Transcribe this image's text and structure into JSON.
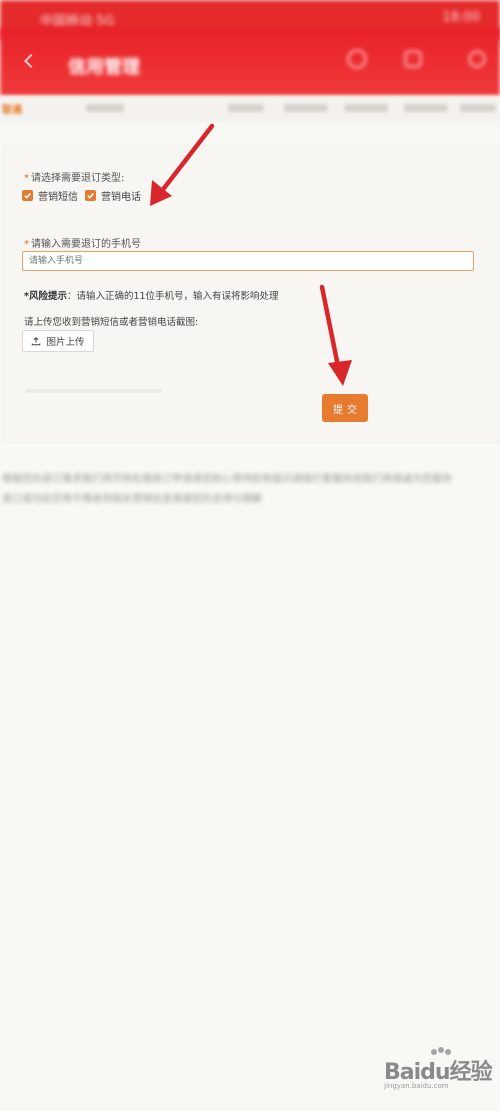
{
  "status_bar": {
    "carrier": "中国移动 5G",
    "time": "18:00"
  },
  "header": {
    "title": "信用管理",
    "back_icon": "back-arrow-icon",
    "icons": [
      "star-icon",
      "share-icon",
      "more-icon"
    ]
  },
  "nav": {
    "brand": "联通"
  },
  "form": {
    "type_label": "请选择需要退订类型:",
    "options": [
      {
        "label": "营销短信",
        "checked": true
      },
      {
        "label": "营销电话",
        "checked": true
      }
    ],
    "phone_label": "请输入需要退订的手机号",
    "phone_placeholder": "请输入手机号",
    "risk_title": "*风险提示",
    "risk_text": "：请输入正确的11位手机号，输入有误将影响处理",
    "upload_label": "请上传您收到营销短信或者营销电话截图:",
    "upload_button": "图片上传",
    "submit_button": "提交",
    "accent_color": "#e77b2f"
  },
  "blurred_text": {
    "line1": "根据您的退订需求我们将尽快处理退订申请请您耐心等待如有疑问请拨打客服热线我们将竭诚为您服务",
    "line2": "退订成功后您将不再收到相关营销信息感谢您的支持与理解"
  },
  "watermark": {
    "brand": "Baidu经验",
    "url": "jingyan.baidu.com"
  }
}
